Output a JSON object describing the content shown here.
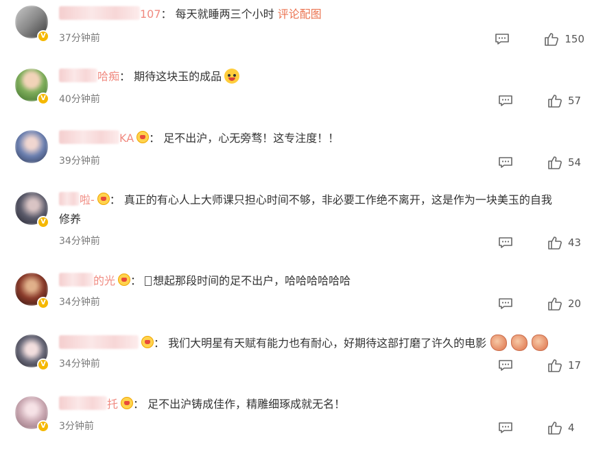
{
  "comments": [
    {
      "user_tail": "107",
      "has_crown": false,
      "text": "每天就睡两三个小时",
      "link": "评论配图",
      "time": "37分钟前",
      "likes": "150",
      "avatar_color": "#9a9a9a"
    },
    {
      "user_tail": "哈痴",
      "has_crown": false,
      "text": "期待这块玉的成品",
      "emoji": "grin-face",
      "time": "40分钟前",
      "likes": "57",
      "avatar_color": "#7fae5b"
    },
    {
      "user_tail": "KA",
      "has_crown": true,
      "text": "足不出沪，心无旁骛！这专注度！！",
      "time": "39分钟前",
      "likes": "54",
      "avatar_color": "#6a7fb0"
    },
    {
      "user_tail": "啦-",
      "has_crown": true,
      "text": "真正的有心人上大师课只担心时间不够，非必要工作绝不离开，这是作为一块美玉的自我",
      "text2": "修养",
      "time": "34分钟前",
      "likes": "43",
      "avatar_color": "#5a5a6a"
    },
    {
      "user_tail": "的光",
      "has_crown": true,
      "text": "想起那段时间的足不出户，哈哈哈哈哈哈",
      "time": "34分钟前",
      "likes": "20",
      "avatar_color": "#8a3a2a"
    },
    {
      "user_tail": "",
      "has_crown": true,
      "text": "我们大明星有天赋有能力也有耐心，好期待这部打磨了许久的电影",
      "emoji": "clap",
      "time": "34分钟前",
      "likes": "17",
      "avatar_color": "#6a6a7a"
    },
    {
      "user_tail": "托",
      "has_crown": true,
      "text": "足不出沪铸成佳作，精雕细琢成就无名！",
      "time": "3分钟前",
      "likes": "4",
      "avatar_color": "#c8a6b0"
    }
  ],
  "colon": "：",
  "icons": {
    "reply": "comment-reply-icon",
    "like": "thumbs-up-icon",
    "verified": "verified-v-icon",
    "crown": "vip-crown-icon"
  },
  "colors": {
    "link": "#eb7350",
    "time": "#7a7a7a",
    "badge": "#f5b800"
  }
}
